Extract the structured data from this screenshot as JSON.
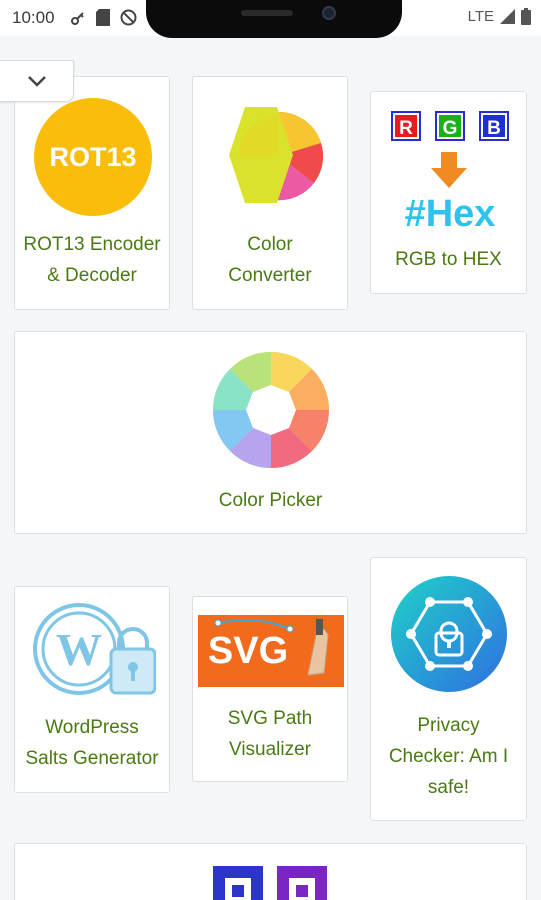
{
  "status_bar": {
    "time": "10:00",
    "network": "LTE",
    "icons": [
      "vpn-key-icon",
      "sd-card-icon",
      "do-not-disturb-icon",
      "signal-icon",
      "battery-icon"
    ]
  },
  "header": {
    "collapse_icon": "chevron-down-icon"
  },
  "colors": {
    "label_green": "#4b7a13",
    "rot13_yellow": "#fbbd0b",
    "privacy_gradient": [
      "#1fd1c9",
      "#2f6fe0"
    ]
  },
  "tools": [
    {
      "name": "ROT13 Encoder & Decoder",
      "line1": "ROT13 Encoder",
      "line2": "& Decoder",
      "logo_text": "ROT13"
    },
    {
      "name": "Color Converter",
      "line1": "Color",
      "line2": "Converter"
    },
    {
      "name": "RGB to HEX",
      "line1": "RGB to HEX",
      "logo_r": "R",
      "logo_g": "G",
      "logo_b": "B",
      "logo_hex": "#Hex"
    },
    {
      "name": "Color Picker",
      "line1": "Color Picker"
    },
    {
      "name": "WordPress Salts Generator",
      "line1": "WordPress",
      "line2": "Salts Generator"
    },
    {
      "name": "SVG Path Visualizer",
      "line1": "SVG Path",
      "line2": "Visualizer",
      "logo_text": "SVG"
    },
    {
      "name": "Privacy Checker: Am I safe!",
      "line1": "Privacy",
      "line2": "Checker: Am I",
      "line3": "safe!"
    },
    {
      "name": "next-tool"
    }
  ]
}
